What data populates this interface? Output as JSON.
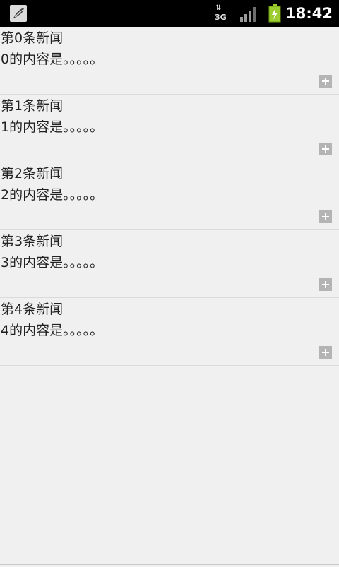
{
  "status_bar": {
    "notification_icon": "satellite-dish-icon",
    "network_label": "3G",
    "network_arrows": "⇅",
    "time": "18:42"
  },
  "news": [
    {
      "title": "第0条新闻",
      "content": "0的内容是。。。。。",
      "action_icon": "plus-icon"
    },
    {
      "title": "第1条新闻",
      "content": "1的内容是。。。。。",
      "action_icon": "plus-icon"
    },
    {
      "title": "第2条新闻",
      "content": "2的内容是。。。。。",
      "action_icon": "plus-icon"
    },
    {
      "title": "第3条新闻",
      "content": "3的内容是。。。。。",
      "action_icon": "plus-icon"
    },
    {
      "title": "第4条新闻",
      "content": "4的内容是。。。。。",
      "action_icon": "plus-icon"
    }
  ]
}
